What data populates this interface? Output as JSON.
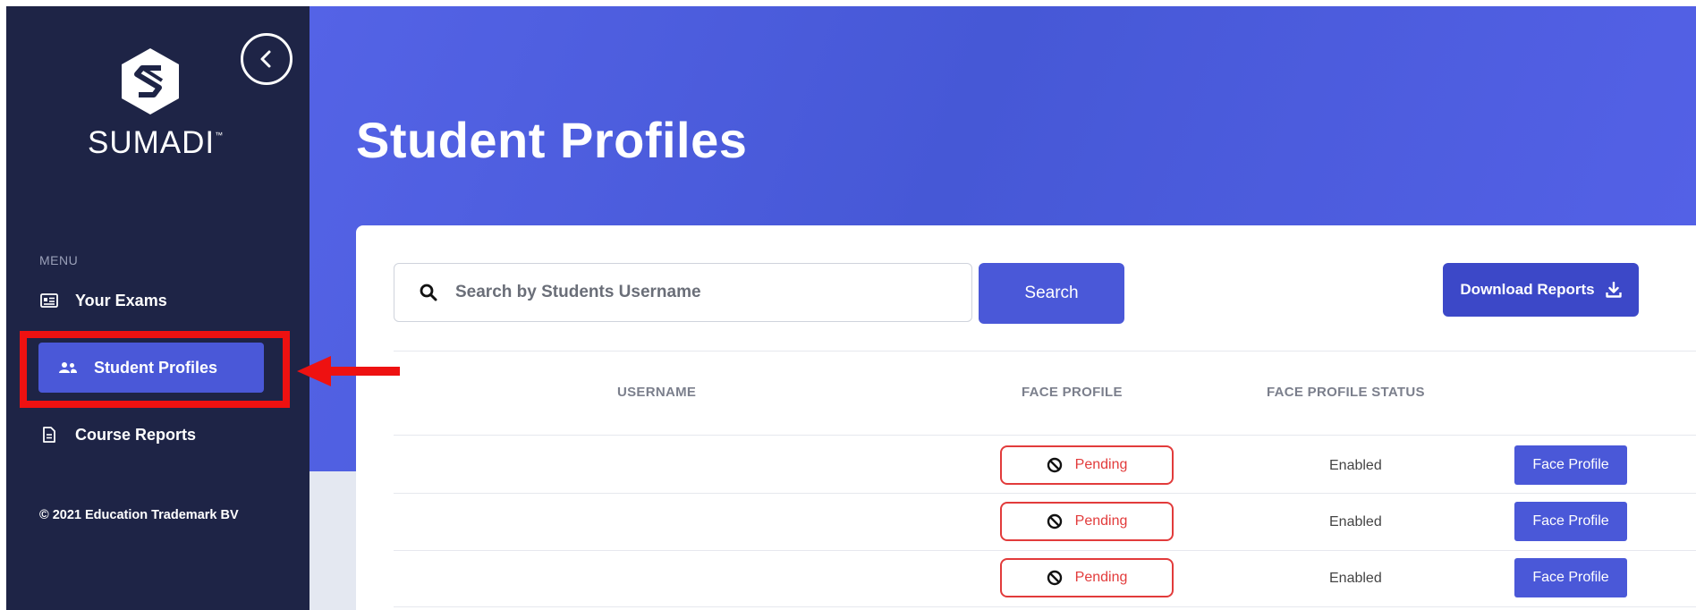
{
  "sidebar": {
    "brand": "SUMADI",
    "brand_mark": "™",
    "menu_heading": "MENU",
    "items": [
      {
        "label": "Your Exams",
        "icon": "id-card-icon"
      },
      {
        "label": "Student Profiles",
        "icon": "users-icon",
        "active": true
      },
      {
        "label": "Course Reports",
        "icon": "document-icon"
      }
    ],
    "footer": "© 2021 Education Trademark BV"
  },
  "header": {
    "title": "Student Profiles"
  },
  "toolbar": {
    "search_placeholder": "Search by Students Username",
    "search_label": "Search",
    "download_label": "Download Reports"
  },
  "table": {
    "columns": [
      "USERNAME",
      "FACE PROFILE",
      "FACE PROFILE STATUS"
    ],
    "rows": [
      {
        "username": "",
        "face_profile": "Pending",
        "status": "Enabled",
        "action": "Face Profile"
      },
      {
        "username": "",
        "face_profile": "Pending",
        "status": "Enabled",
        "action": "Face Profile"
      },
      {
        "username": "",
        "face_profile": "Pending",
        "status": "Enabled",
        "action": "Face Profile"
      }
    ]
  },
  "colors": {
    "sidebar_bg": "#1e2446",
    "accent": "#4a58d8",
    "hero": "#5463e6",
    "pending": "#e23b3b",
    "highlight": "#ee1111"
  }
}
